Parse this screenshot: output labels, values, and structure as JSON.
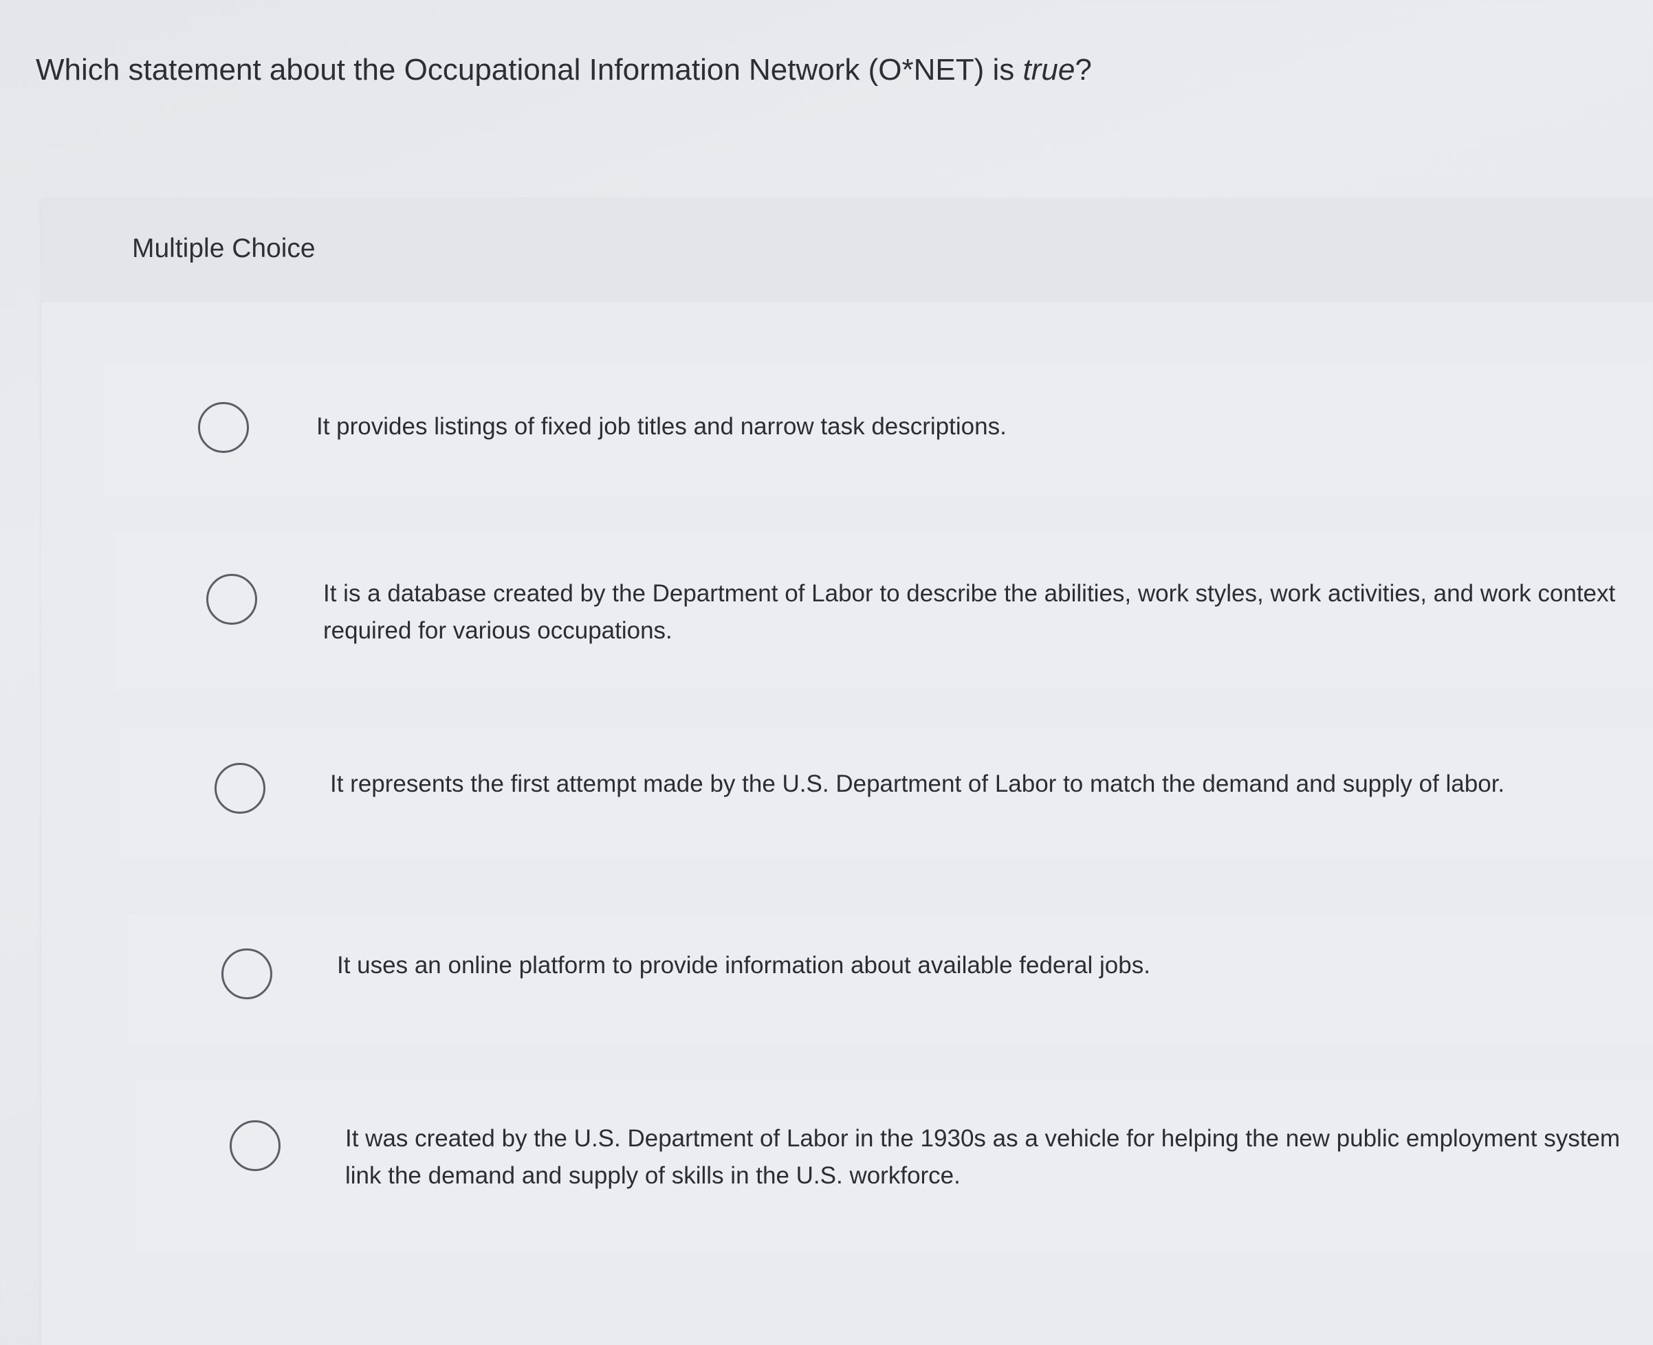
{
  "question": {
    "text_before": "Which statement about the Occupational Information Network (O*NET) is ",
    "text_emphasis": "true",
    "text_after": "?"
  },
  "card": {
    "header_label": "Multiple Choice"
  },
  "options": [
    {
      "text": "It provides listings of fixed job titles and narrow task descriptions."
    },
    {
      "text": "It is a database created by the Department of Labor to describe the abilities, work styles, work activities, and work context required for various occupations."
    },
    {
      "text": "It represents the first attempt made by the U.S. Department of Labor to match the demand and supply of labor."
    },
    {
      "text": "It uses an online platform to provide information about available federal jobs."
    },
    {
      "text": "It was created by the U.S. Department of Labor in the 1930s as a vehicle for helping the new public employment system link the demand and supply of skills in the U.S. workforce."
    }
  ]
}
